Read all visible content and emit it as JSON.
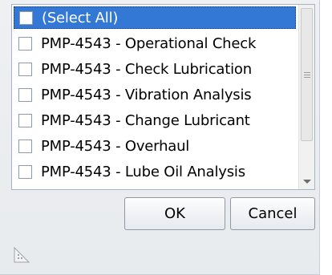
{
  "filter": {
    "items": [
      {
        "label": "(Select All)",
        "checked": false,
        "highlighted": true
      },
      {
        "label": "PMP-4543 - Operational Check",
        "checked": false
      },
      {
        "label": "PMP-4543 - Check Lubrication",
        "checked": false
      },
      {
        "label": "PMP-4543 - Vibration Analysis",
        "checked": false
      },
      {
        "label": "PMP-4543 - Change Lubricant",
        "checked": false
      },
      {
        "label": "PMP-4543 - Overhaul",
        "checked": false
      },
      {
        "label": "PMP-4543 - Lube Oil Analysis",
        "checked": false
      }
    ],
    "ok_label": "OK",
    "cancel_label": "Cancel",
    "highlight_color": "#3478d6",
    "icons": {
      "scroll_down": "chevron-down-icon",
      "scroll_grip": "grip-icon",
      "resize": "resize-grip-icon"
    }
  }
}
